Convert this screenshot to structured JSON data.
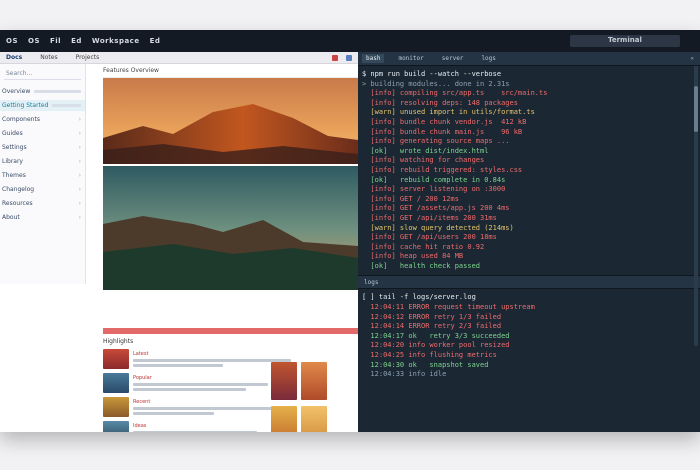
{
  "topbar": {
    "menu": [
      "OS",
      "OS",
      "Fil",
      "Ed",
      "Workspace",
      "Ed"
    ],
    "right_label": "Terminal"
  },
  "browser": {
    "tabs": [
      "Docs",
      "Notes",
      "Projects"
    ],
    "heading": "Features Overview",
    "sidebar": {
      "search_placeholder": "Search...",
      "items": [
        "Overview",
        "Getting Started",
        "Components",
        "Guides",
        "Settings",
        "Library",
        "Themes",
        "Changelog",
        "Resources",
        "About"
      ]
    },
    "news": {
      "headline": "Highlights",
      "subheads": [
        "Latest",
        "Popular",
        "Recent",
        "Ideas"
      ]
    }
  },
  "terminal": {
    "tabs": [
      "bash",
      "monitor",
      "server",
      "logs"
    ],
    "split_tab": "logs",
    "top_lines": [
      {
        "t": "$ npm run build --watch --verbose",
        "c": "c-white"
      },
      {
        "t": "> building modules... done in 2.31s",
        "c": "c-dim"
      },
      {
        "t": "  [info] compiling src/app.ts    src/main.ts",
        "c": "c-red"
      },
      {
        "t": "  [info] resolving deps: 148 packages",
        "c": "c-red"
      },
      {
        "t": "  [warn] unused import in utils/format.ts",
        "c": "c-yel"
      },
      {
        "t": "  [info] bundle chunk vendor.js  412 kB",
        "c": "c-red"
      },
      {
        "t": "  [info] bundle chunk main.js    96 kB",
        "c": "c-red"
      },
      {
        "t": "  [info] generating source maps ...",
        "c": "c-red"
      },
      {
        "t": "  [ok]   wrote dist/index.html",
        "c": "c-green"
      },
      {
        "t": "  [info] watching for changes",
        "c": "c-red"
      },
      {
        "t": "  [info] rebuild triggered: styles.css",
        "c": "c-red"
      },
      {
        "t": "  [ok]   rebuild complete in 0.84s",
        "c": "c-green"
      },
      {
        "t": "  [info] server listening on :3000",
        "c": "c-red"
      },
      {
        "t": "  [info] GET / 200 12ms",
        "c": "c-red"
      },
      {
        "t": "  [info] GET /assets/app.js 200 4ms",
        "c": "c-red"
      },
      {
        "t": "  [info] GET /api/items 200 31ms",
        "c": "c-red"
      },
      {
        "t": "  [warn] slow query detected (214ms)",
        "c": "c-yel"
      },
      {
        "t": "  [info] GET /api/users 200 18ms",
        "c": "c-red"
      },
      {
        "t": "  [info] cache hit ratio 0.92",
        "c": "c-red"
      },
      {
        "t": "  [info] heap used 84 MB",
        "c": "c-red"
      },
      {
        "t": "  [ok]   health check passed",
        "c": "c-green"
      }
    ],
    "bottom_lines": [
      {
        "t": "[ ] tail -f logs/server.log",
        "c": "c-white"
      },
      {
        "t": "  12:04:11 ERROR request timeout upstream",
        "c": "c-red"
      },
      {
        "t": "  12:04:12 ERROR retry 1/3 failed",
        "c": "c-red"
      },
      {
        "t": "  12:04:14 ERROR retry 2/3 failed",
        "c": "c-red"
      },
      {
        "t": "  12:04:17 ok   retry 3/3 succeeded",
        "c": "c-green"
      },
      {
        "t": "  12:04:20 info worker pool resized",
        "c": "c-red"
      },
      {
        "t": "  12:04:25 info flushing metrics",
        "c": "c-red"
      },
      {
        "t": "  12:04:30 ok   snapshot saved",
        "c": "c-green"
      },
      {
        "t": "  12:04:33 info idle",
        "c": "c-dim"
      }
    ]
  },
  "colors": {
    "terminal_bg": "#1b2834",
    "accent": "#1a7fa0",
    "error": "#f06a6a"
  }
}
